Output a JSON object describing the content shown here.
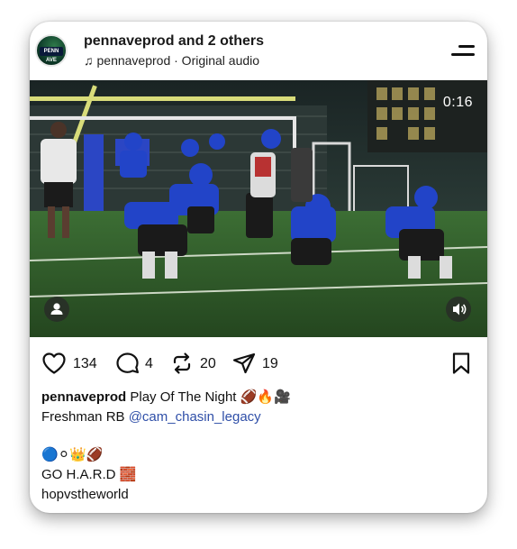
{
  "post": {
    "username_line": "pennaveprod and 2 others",
    "audio_line": "pennaveprod · Original audio",
    "avatar_label": "PENN AVE",
    "video": {
      "timer": "0:16"
    },
    "actions": {
      "likes": "134",
      "comments": "4",
      "reposts": "20",
      "shares": "19"
    },
    "caption": {
      "username": "pennaveprod",
      "line1_text": "Play Of The Night 🏈🔥🎥",
      "line2_prefix": "Freshman RB ",
      "line2_mention": "@cam_chasin_legacy",
      "line3_emoji": "🔵⚪👑🏈",
      "line4_text": "GO H.A.R.D 🧱",
      "line5_text": "hopvstheworld"
    }
  },
  "colors": {
    "mention": "#2f4fa8",
    "field": "#2f6a2e",
    "jersey": "#2244c8"
  }
}
